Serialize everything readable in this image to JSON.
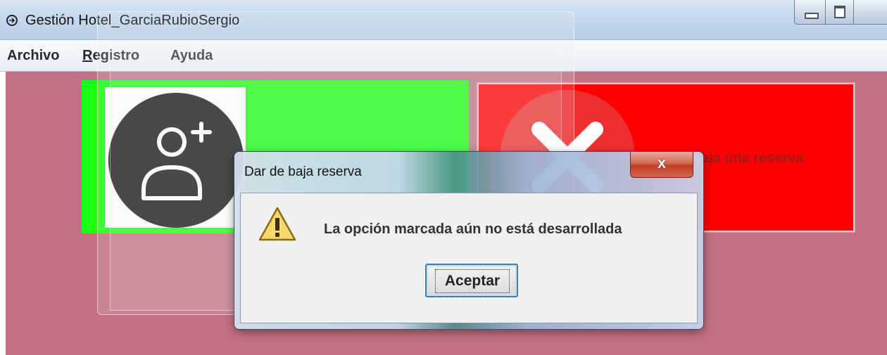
{
  "window": {
    "title": "Gestión Hotel_GarciaRubioSergio"
  },
  "menu": {
    "items": [
      {
        "label": "Archivo"
      },
      {
        "label": "Registro"
      },
      {
        "label": "Ayuda"
      }
    ]
  },
  "panels": {
    "green": {
      "icon": "add-user-icon",
      "color": "#18ff12"
    },
    "red": {
      "icon": "cancel-x-icon",
      "label_partial": "aja una reserva",
      "color": "#ff0000"
    }
  },
  "dialog": {
    "title": "Dar de baja reserva",
    "message": "La opción marcada aún no está desarrollada",
    "ok_label": "Aceptar",
    "close_glyph": "x",
    "icon": "warning-icon"
  },
  "colors": {
    "background": "#c47081",
    "accent_button_border": "#3c7fb1"
  }
}
